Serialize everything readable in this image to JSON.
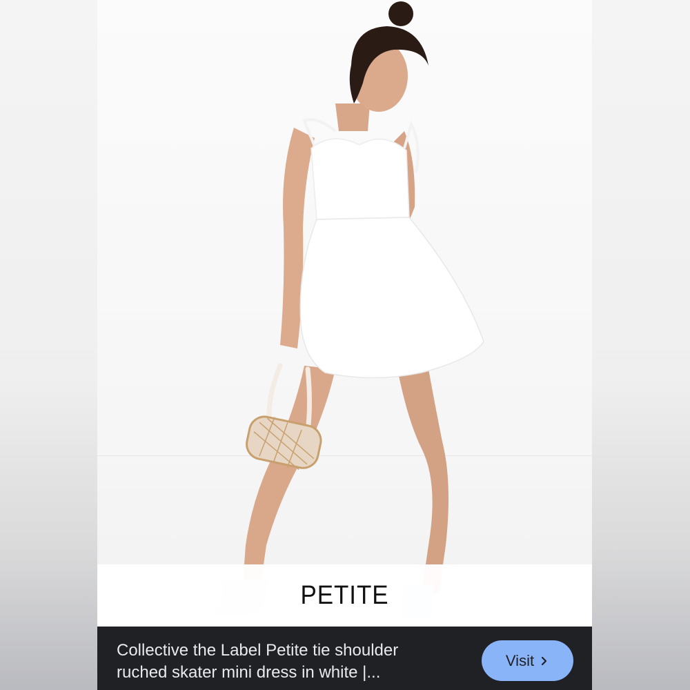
{
  "overlay": {
    "badge_text": "PETITE"
  },
  "caption": {
    "line1": "Collective the Label Petite tie shoulder",
    "line2": "ruched skater mini dress in white |..."
  },
  "visit_button": {
    "label": "Visit",
    "icon": "chevron-right-icon"
  },
  "colors": {
    "caption_bar": "#202124",
    "caption_text": "#e8eaed",
    "visit_button": "#8ab4f8",
    "dress": "#ffffff"
  }
}
